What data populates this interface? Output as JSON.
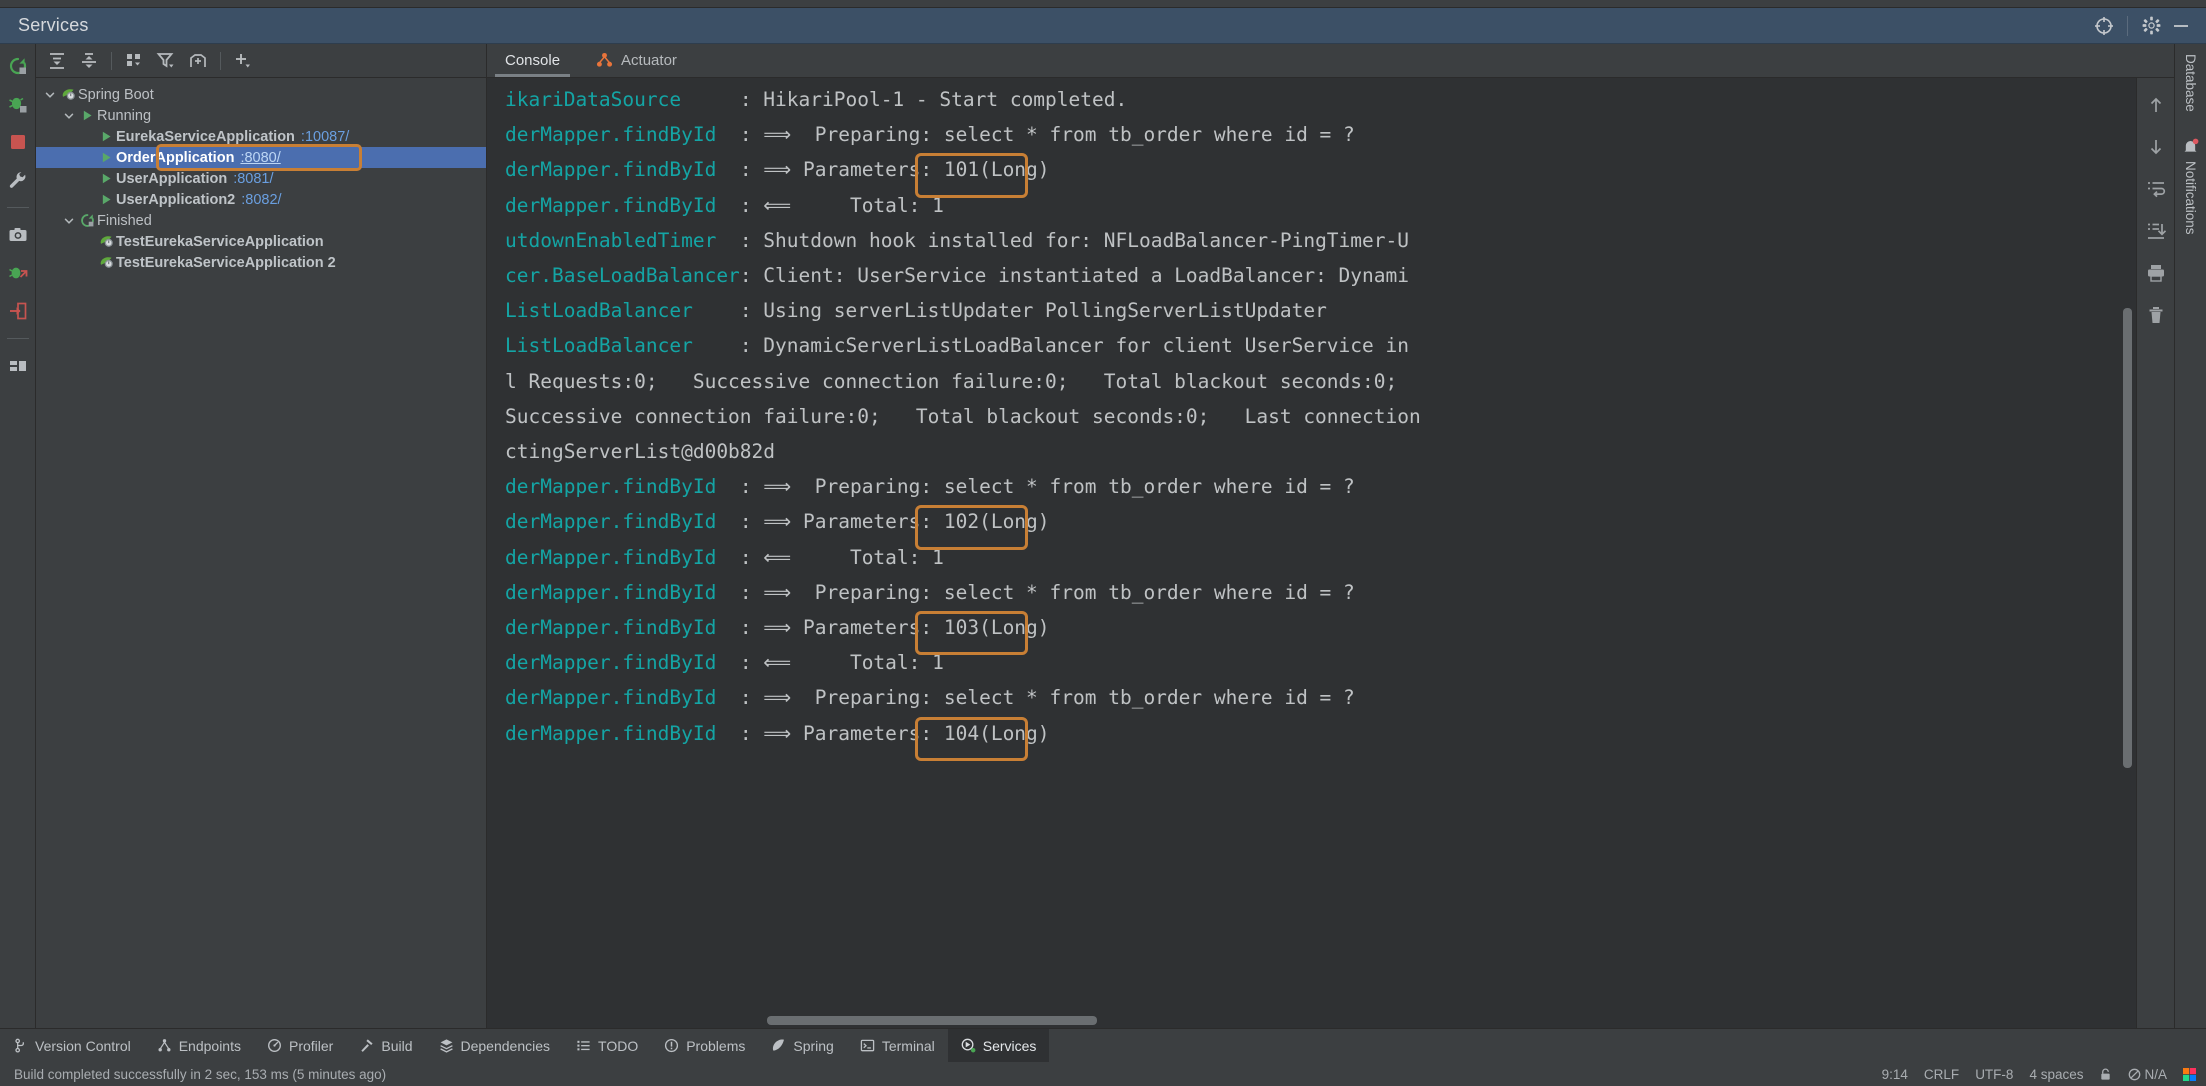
{
  "window": {
    "title": "Services",
    "top_ghost_text": "",
    "locate_icon": "crosshair-target-icon",
    "settings_icon": "gear-icon",
    "minimize_icon": "minimize-icon"
  },
  "left_rail": {
    "items": [
      {
        "name": "rerun-icon",
        "label": "Rerun"
      },
      {
        "name": "debug-icon",
        "label": "Debug"
      },
      {
        "name": "stop-icon",
        "label": "Stop"
      },
      {
        "name": "wrench-icon",
        "label": "Settings"
      },
      {
        "name": "camera-icon",
        "label": "Snapshot"
      },
      {
        "name": "debug-attach-icon",
        "label": "Attach Debugger"
      },
      {
        "name": "login-arrow-icon",
        "label": "Connect"
      },
      {
        "name": "layout-icon",
        "label": "Layout"
      }
    ]
  },
  "tree_toolbar": {
    "buttons": [
      {
        "name": "expand-all-icon",
        "label": "Expand All"
      },
      {
        "name": "collapse-all-icon",
        "label": "Collapse All"
      },
      {
        "name": "group-by-icon",
        "label": "Group By"
      },
      {
        "name": "filter-icon",
        "label": "Filter"
      },
      {
        "name": "add-tab-icon",
        "label": "New Tab"
      },
      {
        "name": "add-icon",
        "label": "Add Service"
      }
    ]
  },
  "tree": {
    "nodes": [
      {
        "id": "spring-boot",
        "label": "Spring Boot",
        "depth": 0,
        "expanded": true,
        "icon": "spring-boot-icon",
        "bold": false,
        "port": "",
        "selected": false
      },
      {
        "id": "running",
        "label": "Running",
        "depth": 1,
        "expanded": true,
        "icon": "run-green-triangle-icon",
        "bold": false,
        "port": "",
        "selected": false
      },
      {
        "id": "eureka-service-application",
        "label": "EurekaServiceApplication",
        "depth": 2,
        "expanded": null,
        "icon": "run-green-triangle-icon",
        "bold": true,
        "port": ":10087/",
        "selected": false
      },
      {
        "id": "order-application",
        "label": "OrderApplication",
        "depth": 2,
        "expanded": null,
        "icon": "run-green-triangle-icon",
        "bold": true,
        "port": ":8080/",
        "selected": true
      },
      {
        "id": "user-application",
        "label": "UserApplication",
        "depth": 2,
        "expanded": null,
        "icon": "run-green-triangle-icon",
        "bold": true,
        "port": ":8081/",
        "selected": false
      },
      {
        "id": "user-application-2",
        "label": "UserApplication2",
        "depth": 2,
        "expanded": null,
        "icon": "run-green-triangle-icon",
        "bold": true,
        "port": ":8082/",
        "selected": false
      },
      {
        "id": "finished",
        "label": "Finished",
        "depth": 1,
        "expanded": true,
        "icon": "rerun-green-icon",
        "bold": false,
        "port": "",
        "selected": false
      },
      {
        "id": "test-eureka-service-application",
        "label": "TestEurekaServiceApplication",
        "depth": 2,
        "expanded": null,
        "icon": "spring-boot-icon",
        "bold": true,
        "port": "",
        "selected": false
      },
      {
        "id": "test-eureka-service-application-2",
        "label": "TestEurekaServiceApplication 2",
        "depth": 2,
        "expanded": null,
        "icon": "spring-boot-icon",
        "bold": true,
        "port": "",
        "selected": false
      }
    ]
  },
  "console_tabs": [
    {
      "label": "Console",
      "active": true,
      "icon": ""
    },
    {
      "label": "Actuator",
      "active": false,
      "icon": "actuator-icon"
    }
  ],
  "console": {
    "lines": [
      {
        "logger": "ikariDataSource",
        "message": ": HikariPool-1 - Start completed."
      },
      {
        "logger": "derMapper.findById",
        "message": ": ⟹  Preparing: select * from tb_order where id = ?"
      },
      {
        "logger": "derMapper.findById",
        "message": ": ⟹ Parameters: 101(Long)"
      },
      {
        "logger": "derMapper.findById",
        "message": ": ⟸     Total: 1"
      },
      {
        "logger": "utdownEnabledTimer",
        "message": ": Shutdown hook installed for: NFLoadBalancer-PingTimer-U"
      },
      {
        "logger": "cer.BaseLoadBalancer",
        "message": ": Client: UserService instantiated a LoadBalancer: Dynami"
      },
      {
        "logger": "ListLoadBalancer",
        "message": ": Using serverListUpdater PollingServerListUpdater"
      },
      {
        "logger": "ListLoadBalancer",
        "message": ": DynamicServerListLoadBalancer for client UserService in"
      },
      {
        "logger": "",
        "message": "l Requests:0;   Successive connection failure:0;   Total blackout seconds:0;"
      },
      {
        "logger": "",
        "message": "Successive connection failure:0;   Total blackout seconds:0;   Last connection"
      },
      {
        "logger": "",
        "message": "ctingServerList@d00b82d"
      },
      {
        "logger": "derMapper.findById",
        "message": ": ⟹  Preparing: select * from tb_order where id = ?"
      },
      {
        "logger": "derMapper.findById",
        "message": ": ⟹ Parameters: 102(Long)"
      },
      {
        "logger": "derMapper.findById",
        "message": ": ⟸     Total: 1"
      },
      {
        "logger": "derMapper.findById",
        "message": ": ⟹  Preparing: select * from tb_order where id = ?"
      },
      {
        "logger": "derMapper.findById",
        "message": ": ⟹ Parameters: 103(Long)"
      },
      {
        "logger": "derMapper.findById",
        "message": ": ⟸     Total: 1"
      },
      {
        "logger": "derMapper.findById",
        "message": ": ⟹  Preparing: select * from tb_order where id = ?"
      },
      {
        "logger": "derMapper.findById",
        "message": ": ⟹ Parameters: 104(Long)"
      }
    ],
    "highlighted_parameters": [
      "101(Long)",
      "102(Long)",
      "103(Long)",
      "104(Long)"
    ],
    "highlight_color": "#c87f35"
  },
  "console_rail": {
    "items": [
      {
        "name": "arrow-up-icon",
        "label": "Previous Occurrence"
      },
      {
        "name": "arrow-down-icon",
        "label": "Next Occurrence"
      },
      {
        "name": "soft-wrap-icon",
        "label": "Soft-Wrap"
      },
      {
        "name": "scroll-to-end-icon",
        "label": "Scroll to End"
      },
      {
        "name": "print-icon",
        "label": "Print"
      },
      {
        "name": "trash-icon",
        "label": "Clear All"
      }
    ]
  },
  "right_strip": {
    "items": [
      {
        "name": "database-tool-window",
        "label": "Database",
        "badge": false
      },
      {
        "name": "notifications-tool-window",
        "label": "Notifications",
        "badge": true,
        "icon": "bell-icon"
      }
    ]
  },
  "bottom_toolbar": {
    "items": [
      {
        "label": "Version Control",
        "icon": "branch-icon",
        "active": false
      },
      {
        "label": "Endpoints",
        "icon": "endpoints-icon",
        "active": false
      },
      {
        "label": "Profiler",
        "icon": "profiler-icon",
        "active": false
      },
      {
        "label": "Build",
        "icon": "hammer-icon",
        "active": false
      },
      {
        "label": "Dependencies",
        "icon": "dependencies-icon",
        "active": false
      },
      {
        "label": "TODO",
        "icon": "todo-list-icon",
        "active": false
      },
      {
        "label": "Problems",
        "icon": "problems-icon",
        "active": false
      },
      {
        "label": "Spring",
        "icon": "spring-leaf-icon",
        "active": false
      },
      {
        "label": "Terminal",
        "icon": "terminal-icon",
        "active": false
      },
      {
        "label": "Services",
        "icon": "services-icon",
        "active": true
      }
    ]
  },
  "status_bar": {
    "message": "Build completed successfully in 2 sec, 153 ms (5 minutes ago)",
    "caret_position": "9:14",
    "line_separator": "CRLF",
    "encoding": "UTF-8",
    "indent": "4 spaces",
    "lock_icon": "lock-icon",
    "inspection": "N/A",
    "inspection_icon": "no-inspection-icon",
    "ide_logo": "intellij-logo-icon"
  }
}
